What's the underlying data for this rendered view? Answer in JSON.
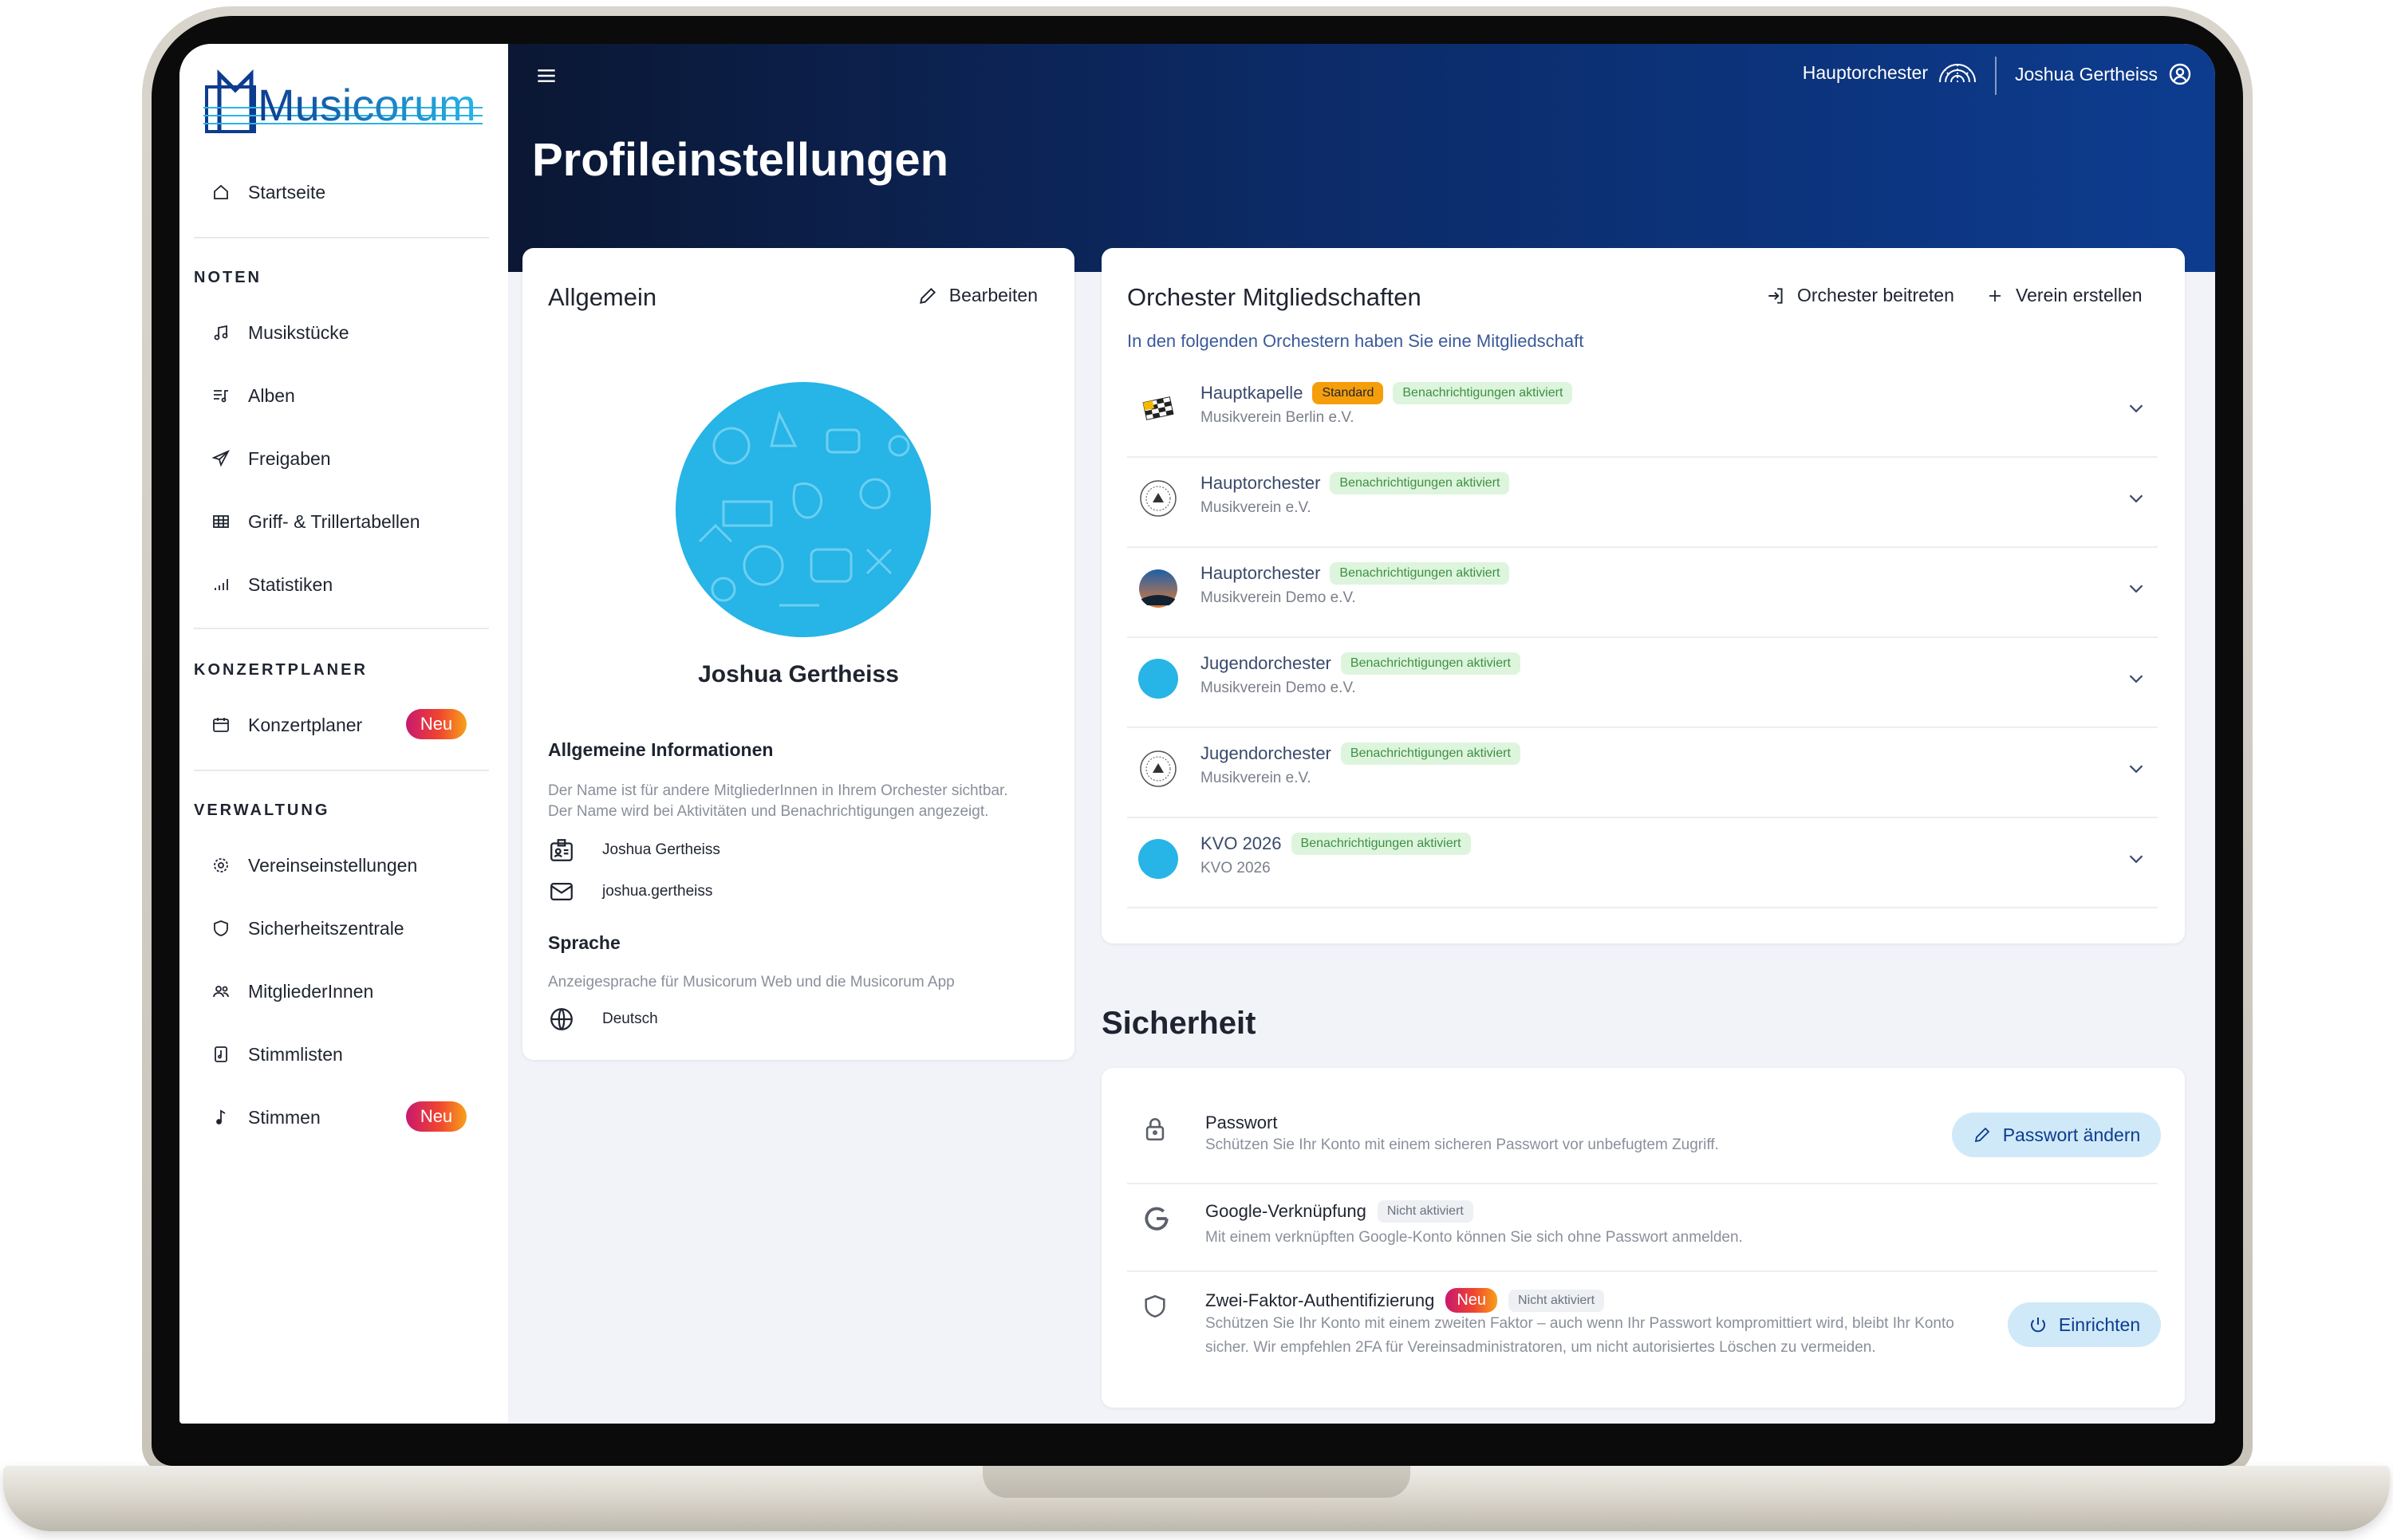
{
  "app": {
    "logo_text": "Musicorum"
  },
  "sidebar": {
    "home": "Startseite",
    "sections": [
      {
        "title": "NOTEN",
        "items": [
          "Musikstücke",
          "Alben",
          "Freigaben",
          "Griff- & Trillertabellen",
          "Statistiken"
        ]
      },
      {
        "title": "KONZERTPLANER",
        "items": [
          "Konzertplaner"
        ]
      },
      {
        "title": "VERWALTUNG",
        "items": [
          "Vereinseinstellungen",
          "Sicherheitszentrale",
          "MitgliederInnen",
          "Stimmlisten",
          "Stimmen"
        ]
      }
    ],
    "new_badge": "Neu"
  },
  "header": {
    "title": "Profileinstellungen",
    "orchestra": "Hauptorchester",
    "user": "Joshua Gertheiss"
  },
  "general": {
    "title": "Allgemein",
    "edit": "Bearbeiten",
    "name": "Joshua Gertheiss",
    "info_title": "Allgemeine Informationen",
    "info_desc_1": "Der Name ist für andere MitgliederInnen in Ihrem Orchester sichtbar.",
    "info_desc_2": "Der Name wird bei Aktivitäten und Benachrichtigungen angezeigt.",
    "display_name": "Joshua Gertheiss",
    "email": "joshua.gertheiss",
    "lang_title": "Sprache",
    "lang_desc": "Anzeigesprache für Musicorum Web und die Musicorum App",
    "language": "Deutsch"
  },
  "memberships": {
    "title": "Orchester Mitgliedschaften",
    "subtitle": "In den folgenden Orchestern haben Sie eine Mitgliedschaft",
    "join": "Orchester beitreten",
    "create": "Verein erstellen",
    "rows": [
      {
        "name": "Hauptkapelle",
        "club": "Musikverein Berlin e.V.",
        "standard": "Standard",
        "notif": "Benachrichtigungen aktiviert"
      },
      {
        "name": "Hauptorchester",
        "club": "Musikverein e.V.",
        "notif": "Benachrichtigungen aktiviert"
      },
      {
        "name": "Hauptorchester",
        "club": "Musikverein Demo e.V.",
        "notif": "Benachrichtigungen aktiviert"
      },
      {
        "name": "Jugendorchester",
        "club": "Musikverein Demo e.V.",
        "notif": "Benachrichtigungen aktiviert"
      },
      {
        "name": "Jugendorchester",
        "club": "Musikverein e.V.",
        "notif": "Benachrichtigungen aktiviert"
      },
      {
        "name": "KVO 2026",
        "club": "KVO 2026",
        "notif": "Benachrichtigungen aktiviert"
      }
    ]
  },
  "security": {
    "title": "Sicherheit",
    "password_title": "Passwort",
    "password_desc": "Schützen Sie Ihr Konto mit einem sicheren Passwort vor unbefugtem Zugriff.",
    "password_btn": "Passwort ändern",
    "google_title": "Google-Verknüpfung",
    "google_status": "Nicht aktiviert",
    "google_desc": "Mit einem verknüpften Google-Konto können Sie sich ohne Passwort anmelden.",
    "tfa_title": "Zwei-Faktor-Authentifizierung",
    "tfa_new": "Neu",
    "tfa_status": "Nicht aktiviert",
    "tfa_desc_1": "Schützen Sie Ihr Konto mit einem zweiten Faktor – auch wenn Ihr Passwort kompromittiert wird, bleibt Ihr Konto",
    "tfa_desc_2": "sicher. Wir empfehlen 2FA für Vereinsadministratoren, um nicht autorisiertes Löschen zu vermeiden.",
    "tfa_btn": "Einrichten"
  }
}
